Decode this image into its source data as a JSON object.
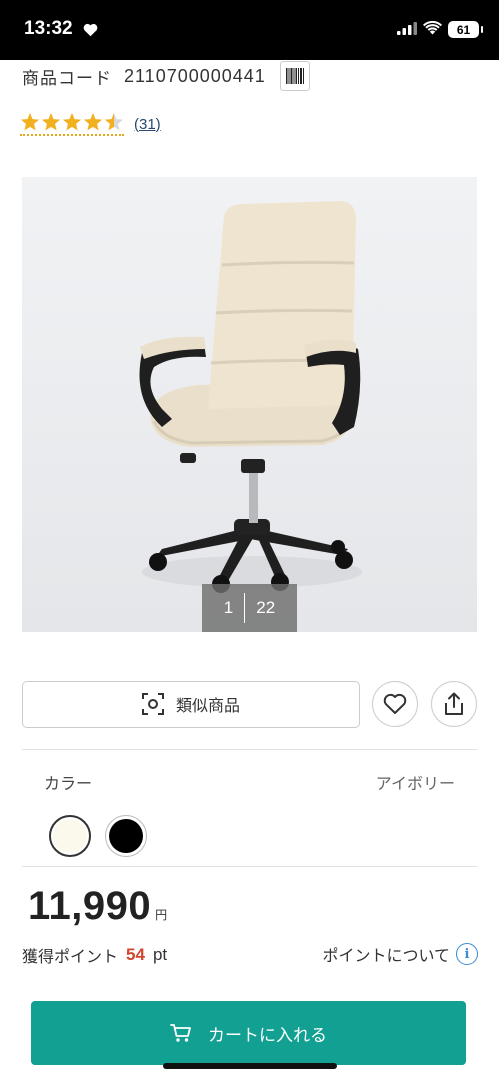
{
  "status_bar": {
    "time": "13:32",
    "battery": "61"
  },
  "product": {
    "code_label": "商品コード",
    "code_value": "2110700000441",
    "rating": 4.5,
    "review_count": "(31)"
  },
  "gallery": {
    "current": "1",
    "total": "22"
  },
  "actions": {
    "similar_label": "類似商品"
  },
  "color": {
    "label": "カラー",
    "selected_name": "アイボリー",
    "options": [
      {
        "name": "ivory",
        "hex": "#fbf8ec",
        "selected": true
      },
      {
        "name": "black",
        "hex": "#000000",
        "selected": false
      }
    ]
  },
  "price": {
    "value": "11,990",
    "unit": "円"
  },
  "points": {
    "label": "獲得ポイント",
    "value": "54",
    "unit": "pt",
    "about": "ポイントについて"
  },
  "cart": {
    "label": "カートに入れる"
  },
  "colors": {
    "accent": "#12a093",
    "points": "#d1452f",
    "star": "#f2b01e",
    "info": "#3a8bd6"
  }
}
